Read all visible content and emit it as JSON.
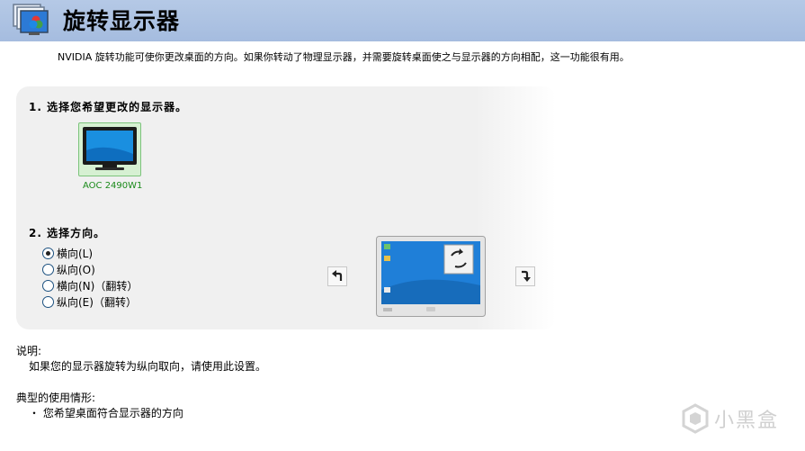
{
  "header": {
    "title": "旋转显示器",
    "icon": "display-settings-icon"
  },
  "intro": "NVIDIA 旋转功能可使你更改桌面的方向。如果你转动了物理显示器，并需要旋转桌面使之与显示器的方向相配，这一功能很有用。",
  "step1": {
    "label": "1. 选择您希望更改的显示器。",
    "monitors": [
      {
        "name": "AOC 2490W1",
        "selected": true
      }
    ]
  },
  "step2": {
    "label": "2. 选择方向。",
    "options": [
      {
        "label": "横向(L)",
        "checked": true
      },
      {
        "label": "纵向(O)",
        "checked": false
      },
      {
        "label": "横向(N)（翻转）",
        "checked": false
      },
      {
        "label": "纵向(E)（翻转）",
        "checked": false
      }
    ]
  },
  "notes": {
    "title": "说明:",
    "text": "如果您的显示器旋转为纵向取向，请使用此设置。"
  },
  "usage": {
    "title": "典型的使用情形:",
    "items": [
      "・ 您希望桌面符合显示器的方向"
    ]
  },
  "watermark": {
    "text": "小黑盒"
  },
  "colors": {
    "header_bg": "#a5bcdf",
    "selected_monitor": "#d6f0d2",
    "monitor_name": "#1a8a1a"
  }
}
